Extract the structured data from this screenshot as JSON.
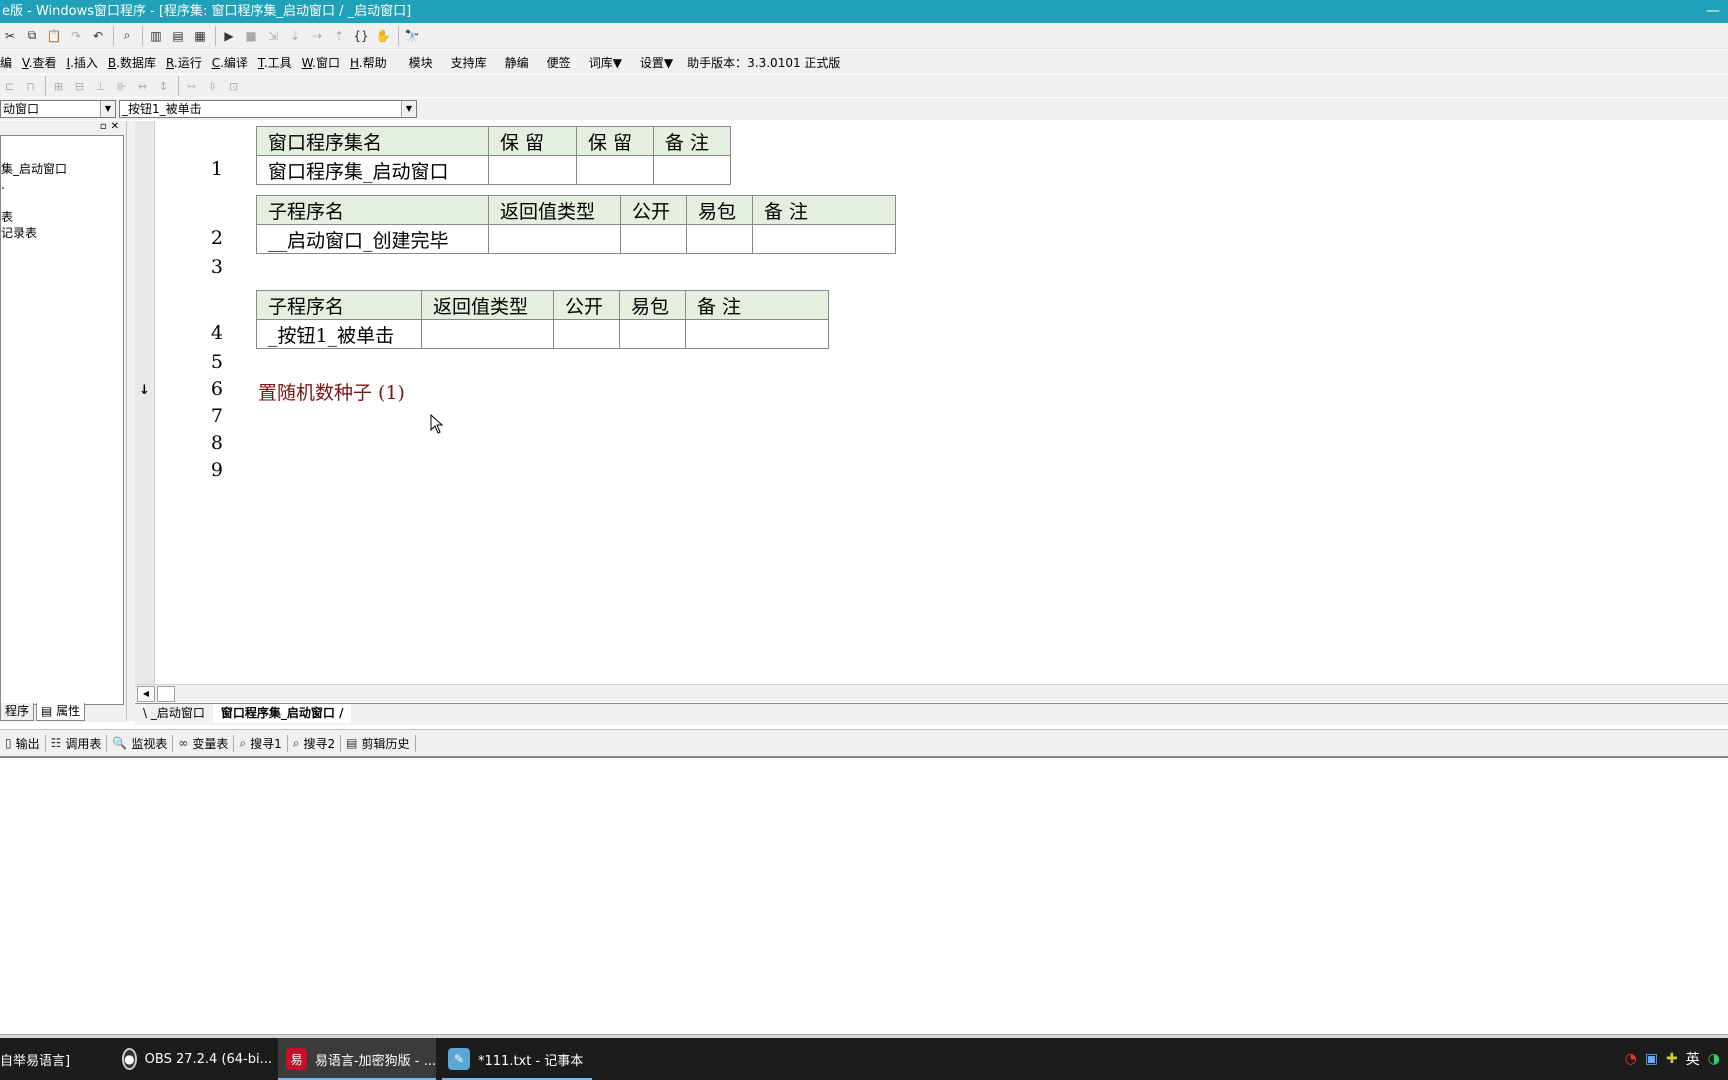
{
  "window": {
    "title": "e版 - Windows窗口程序 - [程序集: 窗口程序集_启动窗口 / _启动窗口]",
    "minimize_glyph": "—"
  },
  "menu": {
    "items": [
      {
        "label": "编",
        "key": ""
      },
      {
        "label": ".查看",
        "key": "V"
      },
      {
        "label": ".插入",
        "key": "I"
      },
      {
        "label": ".数据库",
        "key": "B"
      },
      {
        "label": ".运行",
        "key": "R"
      },
      {
        "label": ".编译",
        "key": "C"
      },
      {
        "label": ".工具",
        "key": "T"
      },
      {
        "label": ".窗口",
        "key": "W"
      },
      {
        "label": ".帮助",
        "key": "H"
      }
    ],
    "extras": [
      "模块",
      "支持库",
      "静编",
      "便签",
      "词库▼",
      "设置▼"
    ],
    "version": "助手版本：3.3.0101 正式版"
  },
  "combos": {
    "left": "动窗口",
    "right": "_按钮1_被单击"
  },
  "tree": {
    "items": [
      "集_启动窗口",
      ".",
      "",
      "表",
      "记录表"
    ]
  },
  "left_tabs": {
    "program": "程序",
    "properties": "属性"
  },
  "code": {
    "line_numbers": [
      "1",
      "2",
      "3",
      "4",
      "5",
      "6",
      "7",
      "8",
      "9"
    ],
    "assembly_table": {
      "headers": [
        "窗口程序集名",
        "保 留",
        "保 留",
        "备 注"
      ],
      "row": [
        "窗口程序集_启动窗口",
        "",
        "",
        ""
      ]
    },
    "sub1_table": {
      "headers": [
        "子程序名",
        "返回值类型",
        "公开",
        "易包",
        "备 注"
      ],
      "row": [
        "__启动窗口_创建完毕",
        "",
        "",
        "",
        ""
      ]
    },
    "sub2_table": {
      "headers": [
        "子程序名",
        "返回值类型",
        "公开",
        "易包",
        "备 注"
      ],
      "row": [
        "_按钮1_被单击",
        "",
        "",
        "",
        ""
      ]
    },
    "statement": "置随机数种子 (1)",
    "flow_arrow": "↓"
  },
  "editor_tabs": {
    "tab1": "_启动窗口",
    "tab2": "窗口程序集_启动窗口"
  },
  "bottom_tabs": [
    "输出",
    "调用表",
    "监视表",
    "变量表",
    "搜寻1",
    "搜寻2",
    "剪辑历史"
  ],
  "taskbar": {
    "items": [
      {
        "label": "自举易语言]",
        "icon": "app-icon"
      },
      {
        "label": "OBS 27.2.4 (64-bi...",
        "icon": "obs-icon"
      },
      {
        "label": "易语言-加密狗版 - ...",
        "icon": "e-lang-icon"
      },
      {
        "label": "*111.txt - 记事本",
        "icon": "notepad-icon"
      }
    ],
    "ime": "英"
  },
  "colors": {
    "titlebar": "#1fa1b7",
    "statement": "#7b1515",
    "table_header": "#e5efe0",
    "taskbar": "#1c1c1c"
  }
}
